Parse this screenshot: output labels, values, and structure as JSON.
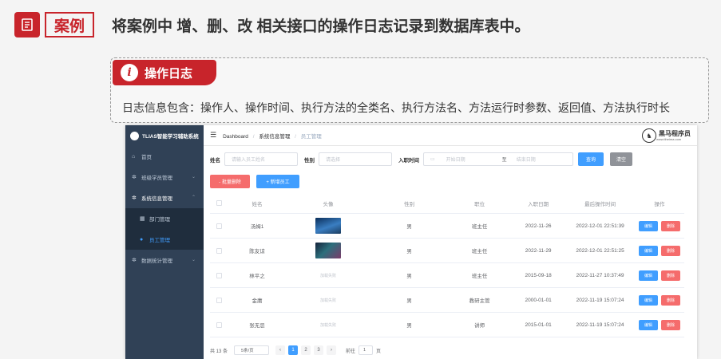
{
  "slide": {
    "tag": "案例",
    "title": "将案例中 增、删、改 相关接口的操作日志记录到数据库表中。",
    "badge": "操作日志",
    "badge_icon": "info-icon",
    "info_text": "日志信息包含：操作人、操作时间、执行方法的全类名、执行方法名、方法运行时参数、返回值、方法执行时长"
  },
  "app": {
    "title": "TLIAS智能学习辅助系统",
    "menu": [
      {
        "label": "首页",
        "icon": "home-icon"
      },
      {
        "label": "班级学员管理",
        "icon": "gear-icon",
        "chevron": "⌄"
      },
      {
        "label": "系统信息管理",
        "icon": "gear-icon",
        "chevron": "⌃"
      },
      {
        "label": "部门管理",
        "icon": "grid-icon"
      },
      {
        "label": "员工管理",
        "icon": "user-icon"
      },
      {
        "label": "数据统计管理",
        "icon": "gear-icon",
        "chevron": "⌄"
      }
    ],
    "breadcrumb": [
      "Dashboard",
      "系统信息管理",
      "员工管理"
    ],
    "breadcrumb_sep": "/",
    "brand": {
      "name": "黑马程序员",
      "sub": "www.itheima.com"
    },
    "search": {
      "name_label": "姓名",
      "name_placeholder": "请输入员工姓名",
      "gender_label": "性别",
      "gender_placeholder": "请选择",
      "date_label": "入职时间",
      "start_placeholder": "开始日期",
      "to": "至",
      "end_placeholder": "结束日期",
      "query": "查询",
      "clear": "清空"
    },
    "actions": {
      "batch_delete": "- 批量删除",
      "add": "+ 新增员工"
    },
    "columns": [
      "姓名",
      "头像",
      "性别",
      "职位",
      "入职日期",
      "最后操作时间",
      "操作"
    ],
    "rows": [
      {
        "name": "汤姆1",
        "avatar": "image",
        "gender": "男",
        "job": "班主任",
        "entry": "2022-11-26",
        "update": "2022-12-01 22:51:39"
      },
      {
        "name": "陈友谅",
        "avatar": "image",
        "gender": "男",
        "job": "班主任",
        "entry": "2022-11-29",
        "update": "2022-12-01 22:51:25"
      },
      {
        "name": "林平之",
        "avatar": "加载失败",
        "gender": "男",
        "job": "班主任",
        "entry": "2015-09-18",
        "update": "2022-11-27 10:37:49"
      },
      {
        "name": "金庸",
        "avatar": "加载失败",
        "gender": "男",
        "job": "教研主管",
        "entry": "2000-01-01",
        "update": "2022-11-19 15:07:24"
      },
      {
        "name": "张无忌",
        "avatar": "加载失败",
        "gender": "男",
        "job": "讲师",
        "entry": "2015-01-01",
        "update": "2022-11-19 15:07:24"
      }
    ],
    "op_edit": "编辑",
    "op_delete": "删除",
    "pager": {
      "total": "共 13 条",
      "size": "5条/页",
      "pages": [
        "1",
        "2",
        "3"
      ],
      "current": "1",
      "goto_label": "前往",
      "goto_value": "1",
      "page_unit": "页"
    },
    "colors": {
      "sidebar": "#304156",
      "primary": "#409eff",
      "danger": "#f56c6c",
      "accent": "#c8242b"
    }
  }
}
